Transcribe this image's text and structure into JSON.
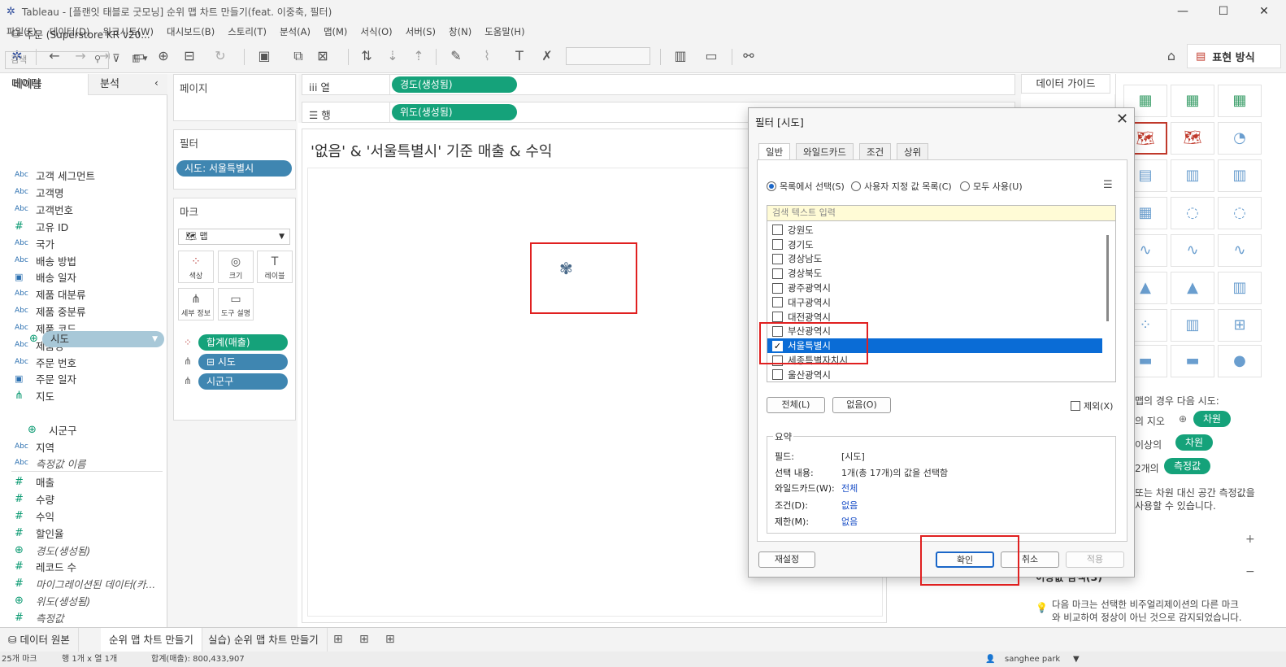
{
  "window": {
    "title": "Tableau - [플랜잇 태블로 굿모닝] 순위 맵 차트 만들기(feat. 이중축, 필터)"
  },
  "menu": [
    "파일(F)",
    "데이터(D)",
    "워크시트(W)",
    "대시보드(B)",
    "스토리(T)",
    "분석(A)",
    "맵(M)",
    "서식(O)",
    "서버(S)",
    "창(N)",
    "도움말(H)"
  ],
  "toolbar": {
    "showme_label": "표현 방식"
  },
  "left": {
    "tab_data": "데이터",
    "tab_analysis": "분석",
    "datasource": "주문 (Superstore KR v20...",
    "search_placeholder": "검색",
    "tables_header": "테이블",
    "fields": [
      {
        "type": "Abc",
        "label": "고객 세그먼트"
      },
      {
        "type": "Abc",
        "label": "고객명"
      },
      {
        "type": "Abc",
        "label": "고객번호"
      },
      {
        "type": "#",
        "label": "고유 ID"
      },
      {
        "type": "Abc",
        "label": "국가"
      },
      {
        "type": "Abc",
        "label": "배송 방법"
      },
      {
        "type": "date",
        "label": "배송 일자"
      },
      {
        "type": "Abc",
        "label": "제품 대분류"
      },
      {
        "type": "Abc",
        "label": "제품 중분류"
      },
      {
        "type": "Abc",
        "label": "제품 코드"
      },
      {
        "type": "Abc",
        "label": "제품명"
      },
      {
        "type": "Abc",
        "label": "주문 번호"
      },
      {
        "type": "date",
        "label": "주문 일자"
      },
      {
        "type": "hier",
        "label": "지도"
      },
      {
        "type": "geo",
        "label": "시도"
      },
      {
        "type": "geo",
        "label": "시군구"
      },
      {
        "type": "Abc",
        "label": "지역"
      },
      {
        "type": "Abc",
        "label": "측정값 이름"
      },
      {
        "type": "#",
        "label": "매출"
      },
      {
        "type": "#",
        "label": "수량"
      },
      {
        "type": "#",
        "label": "수익"
      },
      {
        "type": "#",
        "label": "할인율"
      },
      {
        "type": "geo",
        "label": "경도(생성됨)"
      },
      {
        "type": "#",
        "label": "레코드 수"
      },
      {
        "type": "#",
        "label": "마이그레이션된 데이터(카..."
      },
      {
        "type": "geo",
        "label": "위도(생성됨)"
      },
      {
        "type": "#",
        "label": "측정값"
      }
    ]
  },
  "pages": {
    "title": "페이지"
  },
  "filters": {
    "title": "필터",
    "pill": "시도: 서울특별시"
  },
  "marks": {
    "title": "마크",
    "type": "맵",
    "buttons": [
      "색상",
      "크기",
      "레이블",
      "세부 정보",
      "도구 설명"
    ],
    "pills": [
      "합계(매출)",
      "⊟ 시도",
      "시군구"
    ]
  },
  "shelves": {
    "columns_label": "열",
    "columns_pill": "경도(생성됨)",
    "rows_label": "행",
    "rows_pill": "위도(생성됨)"
  },
  "sheet": {
    "title": "'없음' & '서울특별시' 기준 매출 & 수익"
  },
  "guide": {
    "title": "데이터 가이드",
    "showme_lines": [
      "맵의 경우 다음 시도:",
      "의 지오",
      "이상의",
      "2개의",
      "또는 차원 대신 공간 측정값을",
      "사용할 수 있습니다."
    ],
    "showme_pills": [
      "차원",
      "차원",
      "측정값"
    ],
    "bottom_heading": "이상값 탐색(3)",
    "bottom_text": "다음 마크는 선택한 비주얼리제이션의 다른 마크와 비교하여 정상이 아닌 것으로 감지되었습니다."
  },
  "dialog": {
    "title": "필터 [시도]",
    "tabs": [
      "일반",
      "와일드카드",
      "조건",
      "상위"
    ],
    "radio_list": "목록에서 선택(S)",
    "radio_custom": "사용자 지정 값 목록(C)",
    "radio_all": "모두 사용(U)",
    "search_placeholder": "검색 텍스트 입력",
    "items": [
      {
        "label": "강원도",
        "checked": false
      },
      {
        "label": "경기도",
        "checked": false
      },
      {
        "label": "경상남도",
        "checked": false
      },
      {
        "label": "경상북도",
        "checked": false
      },
      {
        "label": "광주광역시",
        "checked": false
      },
      {
        "label": "대구광역시",
        "checked": false
      },
      {
        "label": "대전광역시",
        "checked": false
      },
      {
        "label": "부산광역시",
        "checked": false
      },
      {
        "label": "서울특별시",
        "checked": true
      },
      {
        "label": "세종특별자치시",
        "checked": false
      },
      {
        "label": "울산광역시",
        "checked": false
      }
    ],
    "btn_all": "전체(L)",
    "btn_none": "없음(O)",
    "exclude": "제외(X)",
    "summary_title": "요약",
    "summary": [
      {
        "key": "필드:",
        "value": "[시도]",
        "link": false
      },
      {
        "key": "선택 내용:",
        "value": "1개(총 17개)의 값을 선택함",
        "link": false
      },
      {
        "key": "와일드카드(W):",
        "value": "전체",
        "link": true
      },
      {
        "key": "조건(D):",
        "value": "없음",
        "link": true
      },
      {
        "key": "제한(M):",
        "value": "없음",
        "link": true
      }
    ],
    "btn_reset": "재설정",
    "btn_ok": "확인",
    "btn_cancel": "취소",
    "btn_apply": "적용"
  },
  "bottom_tabs": [
    "데이터 원본",
    "순위 맵 차트 만들기",
    "실습) 순위 맵 차트 만들기"
  ],
  "status": {
    "marks": "25개 마크",
    "rows": "행 1개 x 열 1개",
    "sum": "합계(매출): 800,433,907",
    "user": "sanghee park"
  }
}
